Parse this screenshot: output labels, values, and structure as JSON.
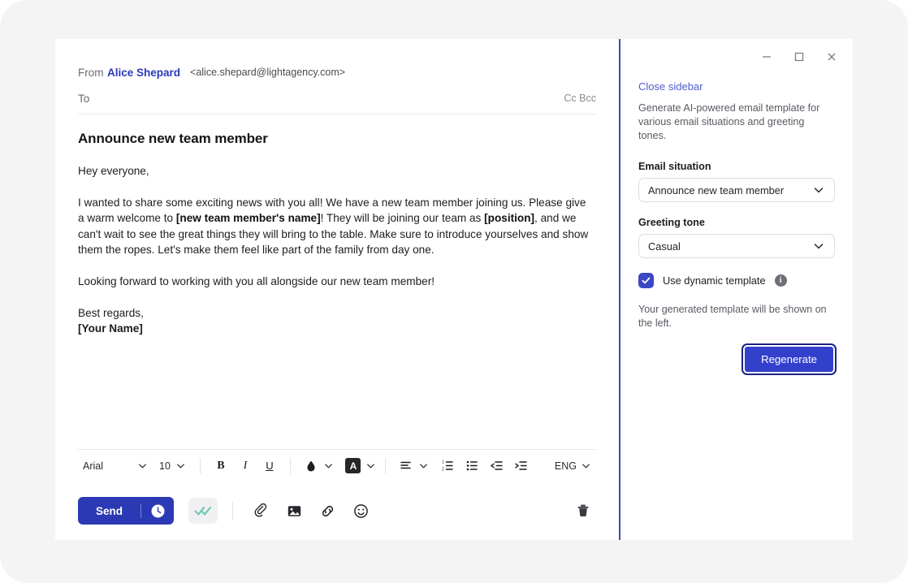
{
  "window": {
    "controls": [
      {
        "name": "minimize",
        "glyph": "minimize-icon"
      },
      {
        "name": "maximize",
        "glyph": "maximize-icon"
      },
      {
        "name": "close",
        "glyph": "close-icon"
      }
    ]
  },
  "compose": {
    "from_label": "From",
    "from_name": "Alice Shepard",
    "from_email": "<alice.shepard@lightagency.com>",
    "to_label": "To",
    "to_value": "",
    "to_placeholder": "",
    "cc_bcc_label": "Cc Bcc",
    "subject": "Announce new team member",
    "greeting": "Hey everyone,",
    "paragraph_1_a": "I wanted to share some exciting news with you all! We have a new team member joining us. Please give a warm welcome to ",
    "paragraph_1_ph1": "[new team member's name]",
    "paragraph_1_b": "! They will be joining our team as ",
    "paragraph_1_ph2": "[position]",
    "paragraph_1_c": ", and we can't wait to see the great things they will bring to the table. Make sure to introduce yourselves and show them the ropes. Let's make them feel like part of the family from day one.",
    "paragraph_2": "Looking forward to working with you all alongside our new team member!",
    "signoff": "Best regards,",
    "signature_name": "[Your Name]"
  },
  "toolbar": {
    "font_family": "Arial",
    "font_size": "10",
    "bold_label": "B",
    "italic_label": "I",
    "underline_label": "U",
    "highlight_label": "A",
    "language": "ENG",
    "icons": {
      "text_color": "droplet-icon",
      "highlight": "highlight-icon",
      "align": "align-left-icon",
      "numbered_list": "numbered-list-icon",
      "bullet_list": "bullet-list-icon",
      "outdent": "outdent-icon",
      "indent": "indent-icon"
    }
  },
  "actions": {
    "send_label": "Send",
    "schedule_icon": "clock-icon",
    "read_receipt_icon": "double-check-icon",
    "attach_icon": "paperclip-icon",
    "image_icon": "image-icon",
    "link_icon": "link-icon",
    "emoji_icon": "emoji-icon",
    "delete_icon": "trash-icon"
  },
  "sidebar": {
    "close_label": "Close sidebar",
    "description": "Generate AI-powered email template for various email situations and greeting tones.",
    "situation_label": "Email situation",
    "situation_value": "Announce new team member",
    "tone_label": "Greeting tone",
    "tone_value": "Casual",
    "dynamic_label": "Use dynamic template",
    "dynamic_checked": true,
    "info_glyph": "i",
    "help_text": "Your generated template will be shown on the left.",
    "regenerate_label": "Regenerate"
  },
  "colors": {
    "accent_blue": "#2b39b5",
    "button_blue": "#3340cc",
    "divider_blue": "#3b47c4",
    "link_blue": "#4f5bd0",
    "receipt_green": "#6ec7ad",
    "page_bg": "#f4f4f5"
  }
}
